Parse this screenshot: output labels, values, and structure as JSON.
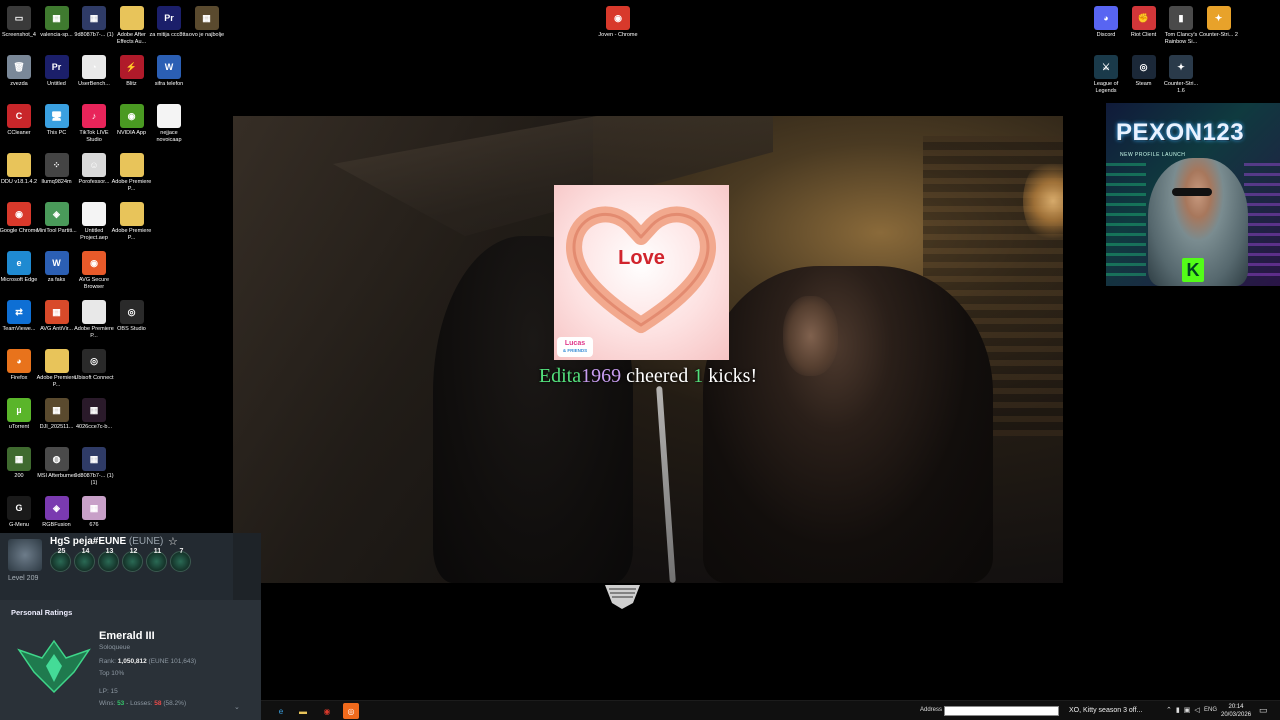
{
  "desktop_left": [
    {
      "label": "Screenshot_4",
      "icon": "screenshot-icon",
      "color": "#3a3a3a",
      "glyph": "▭"
    },
    {
      "label": "valencia-sp...",
      "icon": "image-icon",
      "color": "#3f7a2f",
      "glyph": "▦"
    },
    {
      "label": "9d8087b7-... (1)",
      "icon": "image-icon",
      "color": "#2f3b66",
      "glyph": "▦"
    },
    {
      "label": "Adobe After Effects Au...",
      "icon": "folder-icon",
      "color": "#e8c45a",
      "glyph": ""
    },
    {
      "label": "za mitija ccc8tta",
      "icon": "premiere-icon",
      "color": "#1b1f6a",
      "glyph": "Pr"
    },
    {
      "label": "ovo je najbolje",
      "icon": "video-icon",
      "color": "#5a4a2e",
      "glyph": "▦"
    },
    {
      "label": "zvezda",
      "icon": "recycle-bin-icon",
      "color": "#7a8898",
      "glyph": "🗑"
    },
    {
      "label": "Untitled",
      "icon": "premiere-icon",
      "color": "#1b1f6a",
      "glyph": "Pr"
    },
    {
      "label": "UserBench...",
      "icon": "userbenchmark-icon",
      "color": "#e9e9e9",
      "glyph": "◔"
    },
    {
      "label": "Blitz",
      "icon": "blitz-icon",
      "color": "#b01a2a",
      "glyph": "⚡"
    },
    {
      "label": "sifra telefon",
      "icon": "word-doc-icon",
      "color": "#2b5fb4",
      "glyph": "W"
    },
    {
      "label": "CCleaner",
      "icon": "ccleaner-icon",
      "color": "#c8262a",
      "glyph": "C"
    },
    {
      "label": "This PC",
      "icon": "pc-icon",
      "color": "#3aa0e0",
      "glyph": "🖥"
    },
    {
      "label": "TikTok LIVE Studio",
      "icon": "tiktok-icon",
      "color": "#e8245a",
      "glyph": "♪"
    },
    {
      "label": "NVIDIA App",
      "icon": "nvidia-icon",
      "color": "#4a9a22",
      "glyph": "◉"
    },
    {
      "label": "nejjace novoicaap",
      "icon": "file-icon",
      "color": "#f4f4f4",
      "glyph": ""
    },
    {
      "label": "DDU v18.1.4.2",
      "icon": "ddu-icon",
      "color": "#e8c45a",
      "glyph": ""
    },
    {
      "label": "Ilumq9824m",
      "icon": "dots-icon",
      "color": "#444",
      "glyph": "⁘"
    },
    {
      "label": "Porofessor...",
      "icon": "porofessor-icon",
      "color": "#d9d9d9",
      "glyph": "☺"
    },
    {
      "label": "Adobe Premiere P...",
      "icon": "folder-icon",
      "color": "#e8c45a",
      "glyph": ""
    },
    {
      "label": "Google Chrome",
      "icon": "chrome-icon",
      "color": "#d8392b",
      "glyph": "◉"
    },
    {
      "label": "MiniTool Partiti...",
      "icon": "minitool-icon",
      "color": "#4a9a5a",
      "glyph": "◈"
    },
    {
      "label": "Untitled Project.aep",
      "icon": "file-icon",
      "color": "#f4f4f4",
      "glyph": ""
    },
    {
      "label": "Adobe Premiere P...",
      "icon": "folder-icon",
      "color": "#e8c45a",
      "glyph": ""
    },
    {
      "label": "Microsoft Edge",
      "icon": "edge-icon",
      "color": "#1f8ad1",
      "glyph": "e"
    },
    {
      "label": "za faks",
      "icon": "word-doc-icon",
      "color": "#2b5fb4",
      "glyph": "W"
    },
    {
      "label": "AVG Secure Browser",
      "icon": "avg-browser-icon",
      "color": "#e85a2a",
      "glyph": "◉"
    },
    {
      "label": "TeamViewe...",
      "icon": "teamviewer-icon",
      "color": "#0e6fd4",
      "glyph": "⇄"
    },
    {
      "label": "AVG AntiVir...",
      "icon": "avg-icon",
      "color": "#d84a2a",
      "glyph": "▦"
    },
    {
      "label": "Adobe Premiere P...",
      "icon": "doc-icon",
      "color": "#e8e8e8",
      "glyph": ""
    },
    {
      "label": "OBS Studio",
      "icon": "obs-icon",
      "color": "#2a2a2a",
      "glyph": "◎"
    },
    {
      "label": "Firefox",
      "icon": "firefox-icon",
      "color": "#e8731c",
      "glyph": "◕"
    },
    {
      "label": "Adobe Premiere P...",
      "icon": "folder-icon",
      "color": "#e8c45a",
      "glyph": ""
    },
    {
      "label": "Ubisoft Connect",
      "icon": "ubisoft-icon",
      "color": "#2a2a2a",
      "glyph": "◎"
    },
    {
      "label": "uTorrent",
      "icon": "utorrent-icon",
      "color": "#5ab52a",
      "glyph": "µ"
    },
    {
      "label": "DJI_202511...",
      "icon": "video-icon",
      "color": "#5a4a2e",
      "glyph": "▦"
    },
    {
      "label": "4026cce7c-b...",
      "icon": "image-icon",
      "color": "#2a1a2a",
      "glyph": "▦"
    },
    {
      "label": "200",
      "icon": "image-icon",
      "color": "#3f6a2f",
      "glyph": "▦"
    },
    {
      "label": "MSI Afterburner",
      "icon": "msi-icon",
      "color": "#4a4a4a",
      "glyph": "◍"
    },
    {
      "label": "9d8087b7-... (1) (1)",
      "icon": "image-icon",
      "color": "#2f3b66",
      "glyph": "▦"
    },
    {
      "label": "G-Menu",
      "icon": "gmenu-icon",
      "color": "#1a1a1a",
      "glyph": "G"
    },
    {
      "label": "RGBFusion",
      "icon": "rgbfusion-icon",
      "color": "#7a3ab0",
      "glyph": "◈"
    },
    {
      "label": "676",
      "icon": "image-icon",
      "color": "#c8a0c8",
      "glyph": "▦"
    }
  ],
  "desktop_top": [
    {
      "label": "Joven - Chrome",
      "icon": "chrome-icon",
      "color": "#d8392b",
      "glyph": "◉"
    }
  ],
  "desktop_right": [
    {
      "label": "Discord",
      "icon": "discord-icon",
      "color": "#5865f2",
      "glyph": "◕"
    },
    {
      "label": "Riot Client",
      "icon": "riot-icon",
      "color": "#d13639",
      "glyph": "✊"
    },
    {
      "label": "Tom Clancy's Rainbow Si...",
      "icon": "rainbow-six-icon",
      "color": "#4a4a4a",
      "glyph": "▮"
    },
    {
      "label": "Counter-Stri... 2",
      "icon": "cs2-icon",
      "color": "#e8a22a",
      "glyph": "✦"
    },
    {
      "label": "League of Legends",
      "icon": "league-icon",
      "color": "#1a3a4a",
      "glyph": "⚔"
    },
    {
      "label": "Steam",
      "icon": "steam-icon",
      "color": "#1b2838",
      "glyph": "◎"
    },
    {
      "label": "Counter-Stri... 1.6",
      "icon": "cs16-icon",
      "color": "#2a3a4a",
      "glyph": "✦"
    }
  ],
  "stream": {
    "card_text": "Love",
    "card_brand": "Lucas",
    "card_brand_sub": "& FRIENDS",
    "alert_user_a": "Edita",
    "alert_user_b": "1969",
    "alert_mid": "cheered",
    "alert_amount": "1",
    "alert_end": "kicks!"
  },
  "webcam": {
    "channel_name": "PEXON123",
    "subtitle": "NEW PROFILE LAUNCH",
    "kick_logo": "K"
  },
  "league": {
    "summoner": "HgS peja#EUNE",
    "region_tag": "(EUNE)",
    "level": "Level 209",
    "badges": [
      "25",
      "14",
      "13",
      "12",
      "11",
      "7"
    ],
    "section_title": "Personal Ratings",
    "rank_name": "Emerald III",
    "queue": "Soloqueue",
    "rank_label": "Rank:",
    "rank_value": "1,050,812",
    "rank_region": "(EUNE 101,643)",
    "top_percent": "Top 10%",
    "lp": "LP: 15",
    "wins_label": "Wins:",
    "wins": "53",
    "losses_label": "- Losses:",
    "losses": "58",
    "winrate": "(58.2%)"
  },
  "taskbar": {
    "address_label": "Address",
    "media_title": "XO, Kitty season 3 off...",
    "lang": "ENG",
    "time": "20:14",
    "date": "20/03/2026"
  }
}
